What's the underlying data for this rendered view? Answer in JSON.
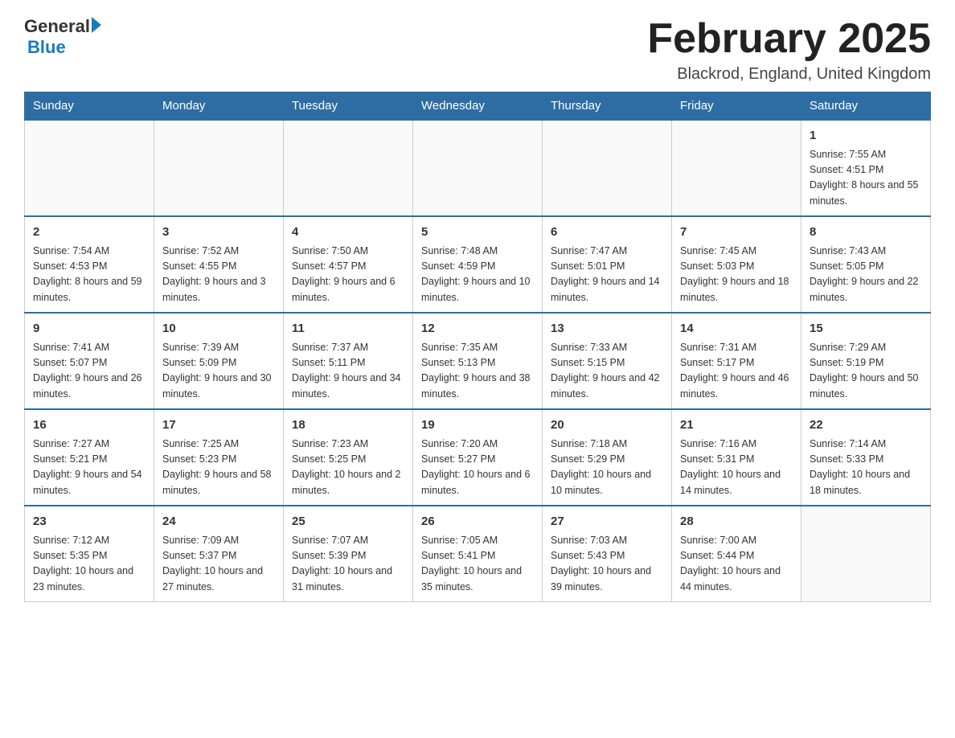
{
  "header": {
    "logo_text_general": "General",
    "logo_text_blue": "Blue",
    "month_title": "February 2025",
    "location": "Blackrod, England, United Kingdom"
  },
  "days_of_week": [
    "Sunday",
    "Monday",
    "Tuesday",
    "Wednesday",
    "Thursday",
    "Friday",
    "Saturday"
  ],
  "weeks": [
    [
      {
        "day": "",
        "info": ""
      },
      {
        "day": "",
        "info": ""
      },
      {
        "day": "",
        "info": ""
      },
      {
        "day": "",
        "info": ""
      },
      {
        "day": "",
        "info": ""
      },
      {
        "day": "",
        "info": ""
      },
      {
        "day": "1",
        "info": "Sunrise: 7:55 AM\nSunset: 4:51 PM\nDaylight: 8 hours and 55 minutes."
      }
    ],
    [
      {
        "day": "2",
        "info": "Sunrise: 7:54 AM\nSunset: 4:53 PM\nDaylight: 8 hours and 59 minutes."
      },
      {
        "day": "3",
        "info": "Sunrise: 7:52 AM\nSunset: 4:55 PM\nDaylight: 9 hours and 3 minutes."
      },
      {
        "day": "4",
        "info": "Sunrise: 7:50 AM\nSunset: 4:57 PM\nDaylight: 9 hours and 6 minutes."
      },
      {
        "day": "5",
        "info": "Sunrise: 7:48 AM\nSunset: 4:59 PM\nDaylight: 9 hours and 10 minutes."
      },
      {
        "day": "6",
        "info": "Sunrise: 7:47 AM\nSunset: 5:01 PM\nDaylight: 9 hours and 14 minutes."
      },
      {
        "day": "7",
        "info": "Sunrise: 7:45 AM\nSunset: 5:03 PM\nDaylight: 9 hours and 18 minutes."
      },
      {
        "day": "8",
        "info": "Sunrise: 7:43 AM\nSunset: 5:05 PM\nDaylight: 9 hours and 22 minutes."
      }
    ],
    [
      {
        "day": "9",
        "info": "Sunrise: 7:41 AM\nSunset: 5:07 PM\nDaylight: 9 hours and 26 minutes."
      },
      {
        "day": "10",
        "info": "Sunrise: 7:39 AM\nSunset: 5:09 PM\nDaylight: 9 hours and 30 minutes."
      },
      {
        "day": "11",
        "info": "Sunrise: 7:37 AM\nSunset: 5:11 PM\nDaylight: 9 hours and 34 minutes."
      },
      {
        "day": "12",
        "info": "Sunrise: 7:35 AM\nSunset: 5:13 PM\nDaylight: 9 hours and 38 minutes."
      },
      {
        "day": "13",
        "info": "Sunrise: 7:33 AM\nSunset: 5:15 PM\nDaylight: 9 hours and 42 minutes."
      },
      {
        "day": "14",
        "info": "Sunrise: 7:31 AM\nSunset: 5:17 PM\nDaylight: 9 hours and 46 minutes."
      },
      {
        "day": "15",
        "info": "Sunrise: 7:29 AM\nSunset: 5:19 PM\nDaylight: 9 hours and 50 minutes."
      }
    ],
    [
      {
        "day": "16",
        "info": "Sunrise: 7:27 AM\nSunset: 5:21 PM\nDaylight: 9 hours and 54 minutes."
      },
      {
        "day": "17",
        "info": "Sunrise: 7:25 AM\nSunset: 5:23 PM\nDaylight: 9 hours and 58 minutes."
      },
      {
        "day": "18",
        "info": "Sunrise: 7:23 AM\nSunset: 5:25 PM\nDaylight: 10 hours and 2 minutes."
      },
      {
        "day": "19",
        "info": "Sunrise: 7:20 AM\nSunset: 5:27 PM\nDaylight: 10 hours and 6 minutes."
      },
      {
        "day": "20",
        "info": "Sunrise: 7:18 AM\nSunset: 5:29 PM\nDaylight: 10 hours and 10 minutes."
      },
      {
        "day": "21",
        "info": "Sunrise: 7:16 AM\nSunset: 5:31 PM\nDaylight: 10 hours and 14 minutes."
      },
      {
        "day": "22",
        "info": "Sunrise: 7:14 AM\nSunset: 5:33 PM\nDaylight: 10 hours and 18 minutes."
      }
    ],
    [
      {
        "day": "23",
        "info": "Sunrise: 7:12 AM\nSunset: 5:35 PM\nDaylight: 10 hours and 23 minutes."
      },
      {
        "day": "24",
        "info": "Sunrise: 7:09 AM\nSunset: 5:37 PM\nDaylight: 10 hours and 27 minutes."
      },
      {
        "day": "25",
        "info": "Sunrise: 7:07 AM\nSunset: 5:39 PM\nDaylight: 10 hours and 31 minutes."
      },
      {
        "day": "26",
        "info": "Sunrise: 7:05 AM\nSunset: 5:41 PM\nDaylight: 10 hours and 35 minutes."
      },
      {
        "day": "27",
        "info": "Sunrise: 7:03 AM\nSunset: 5:43 PM\nDaylight: 10 hours and 39 minutes."
      },
      {
        "day": "28",
        "info": "Sunrise: 7:00 AM\nSunset: 5:44 PM\nDaylight: 10 hours and 44 minutes."
      },
      {
        "day": "",
        "info": ""
      }
    ]
  ]
}
